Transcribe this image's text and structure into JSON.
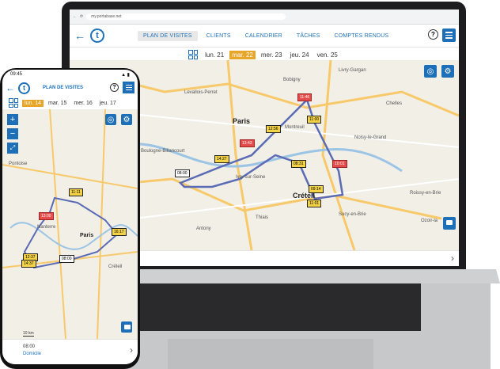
{
  "browser": {
    "url": "my.portabase.net"
  },
  "laptop": {
    "nav_tabs": [
      "PLAN DE VISITES",
      "CLIENTS",
      "CALENDRIER",
      "TÂCHES",
      "COMPTES RENDUS"
    ],
    "days": [
      "lun. 21",
      "mar. 22",
      "mer. 23",
      "jeu. 24",
      "ven. 25"
    ],
    "active_day_index": 1,
    "places": [
      "Livry-Gargan",
      "Bobigny",
      "Levallois-Perret",
      "Chelles",
      "Paris",
      "Montreuil",
      "Noisy-le-Grand",
      "Boulogne-Billancourt",
      "Ivry-sur-Seine",
      "Créteil",
      "Roissy-en-Brie",
      "Sucy-en-Brie",
      "Antony",
      "Thiais",
      "Ozoir-la"
    ],
    "pins": [
      "11:46",
      "11:00",
      "12:56",
      "13:43",
      "14:27",
      "08:00",
      "08:31",
      "10:01",
      "09:14",
      "11:01"
    ]
  },
  "phone": {
    "time": "09:45",
    "title": "PLAN DE VISITES",
    "days": [
      "lun. 14",
      "mar. 15",
      "mer. 16",
      "jeu. 17"
    ],
    "active_day_index": 0,
    "places": [
      "Paris",
      "Nanterre",
      "Créteil",
      "Pontoise"
    ],
    "pins": [
      "11:11",
      "13:00",
      "16:17",
      "12:37",
      "14:37",
      "08:00"
    ],
    "footer_time": "08:00",
    "footer_label": "Domicile",
    "scale": "10 km"
  },
  "colors": {
    "accent": "#1d70b8",
    "active_day": "#e7a52a",
    "route": "#5b6bb5"
  }
}
